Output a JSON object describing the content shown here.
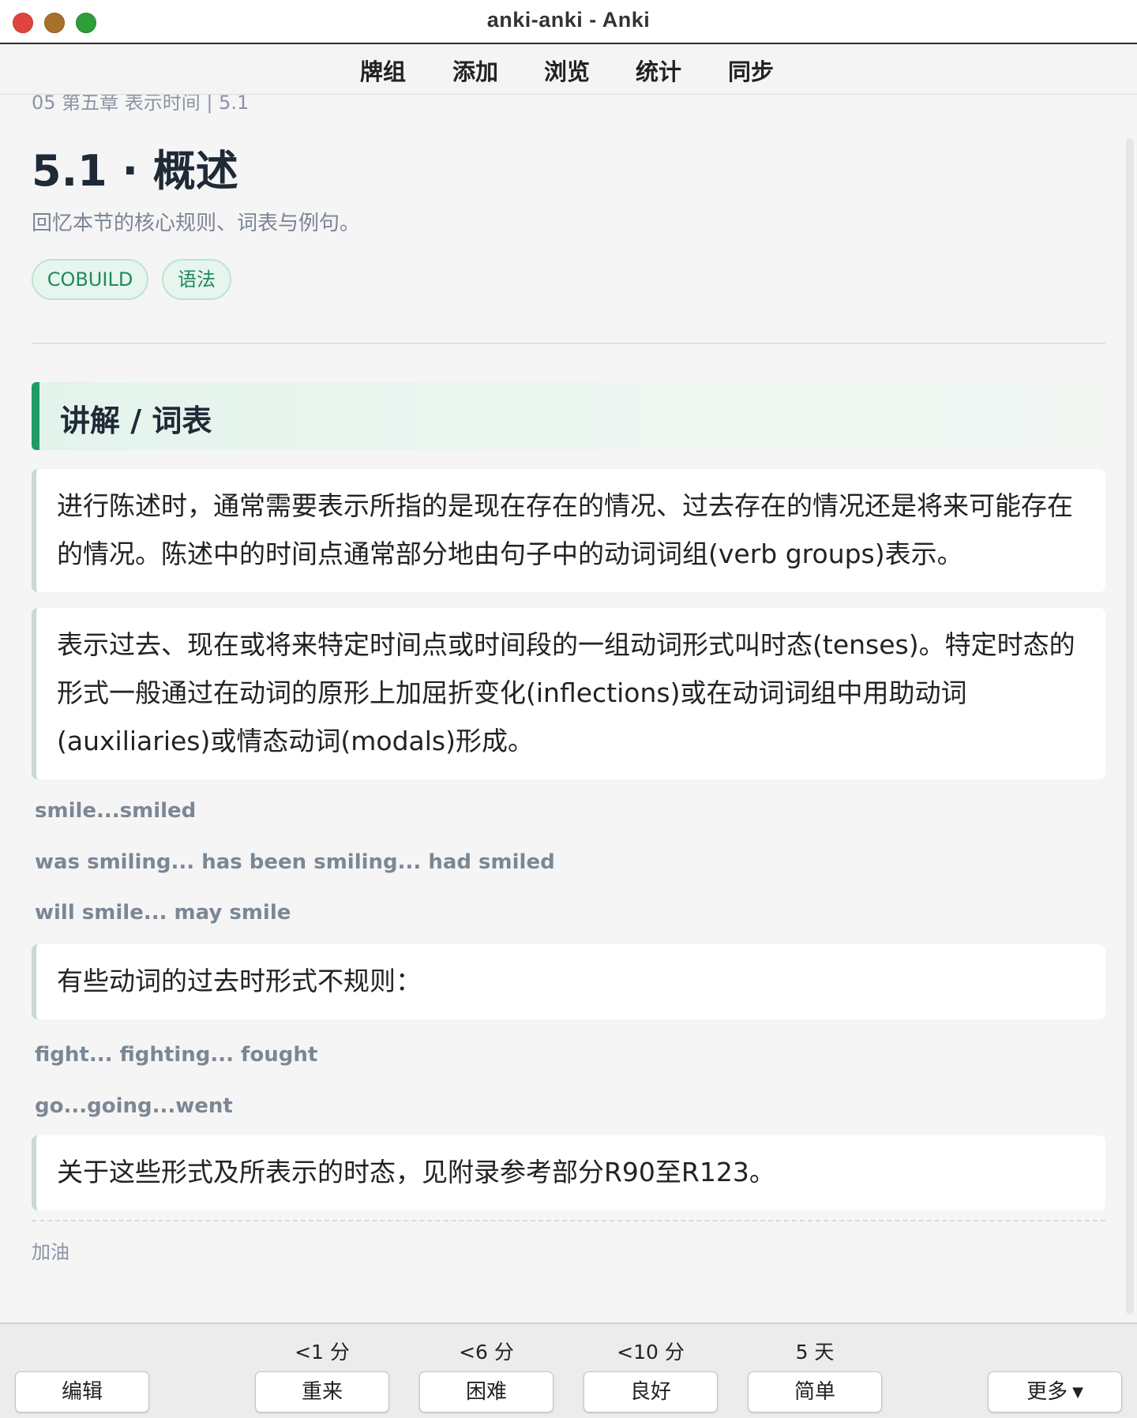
{
  "window": {
    "title": "anki-anki - Anki"
  },
  "toolbar": {
    "items": [
      {
        "label": "牌组"
      },
      {
        "label": "添加"
      },
      {
        "label": "浏览"
      },
      {
        "label": "统计"
      },
      {
        "label": "同步"
      }
    ]
  },
  "card": {
    "breadcrumb": "05 第五章 表示时间 | 5.1",
    "title": "5.1 · 概述",
    "subtitle": "回忆本节的核心规则、词表与例句。",
    "tags": [
      "COBUILD",
      "语法"
    ],
    "section_heading": "讲解 / 词表",
    "paragraphs": [
      "进行陈述时，通常需要表示所指的是现在存在的情况、过去存在的情况还是将来可能存在的情况。陈述中的时间点通常部分地由句子中的动词词组(verb groups)表示。",
      "表示过去、现在或将来特定时间点或时间段的一组动词形式叫时态(tenses)。特定时态的形式一般通过在动词的原形上加屈折变化(inflections)或在动词词组中用助动词(auxiliaries)或情态动词(modals)形成。",
      "有些动词的过去时形式不规则：",
      "关于这些形式及所表示的时态，见附录参考部分R90至R123。"
    ],
    "examples": [
      "smile...smiled",
      "was smiling... has been smiling... had smiled",
      "will smile... may smile",
      "fight... fighting... fought",
      "go...going...went"
    ],
    "footer_note": "加油"
  },
  "answer_bar": {
    "edit_label": "编辑",
    "buttons": [
      {
        "interval": "<1 分",
        "label": "重来"
      },
      {
        "interval": "<6 分",
        "label": "困难"
      },
      {
        "interval": "<10 分",
        "label": "良好"
      },
      {
        "interval": "5 天",
        "label": "简单"
      }
    ],
    "more_label": "更多"
  },
  "colors": {
    "accent": "#1f9c66",
    "tag_bg": "#e6f5ee",
    "tag_text": "#1f8a5c"
  }
}
